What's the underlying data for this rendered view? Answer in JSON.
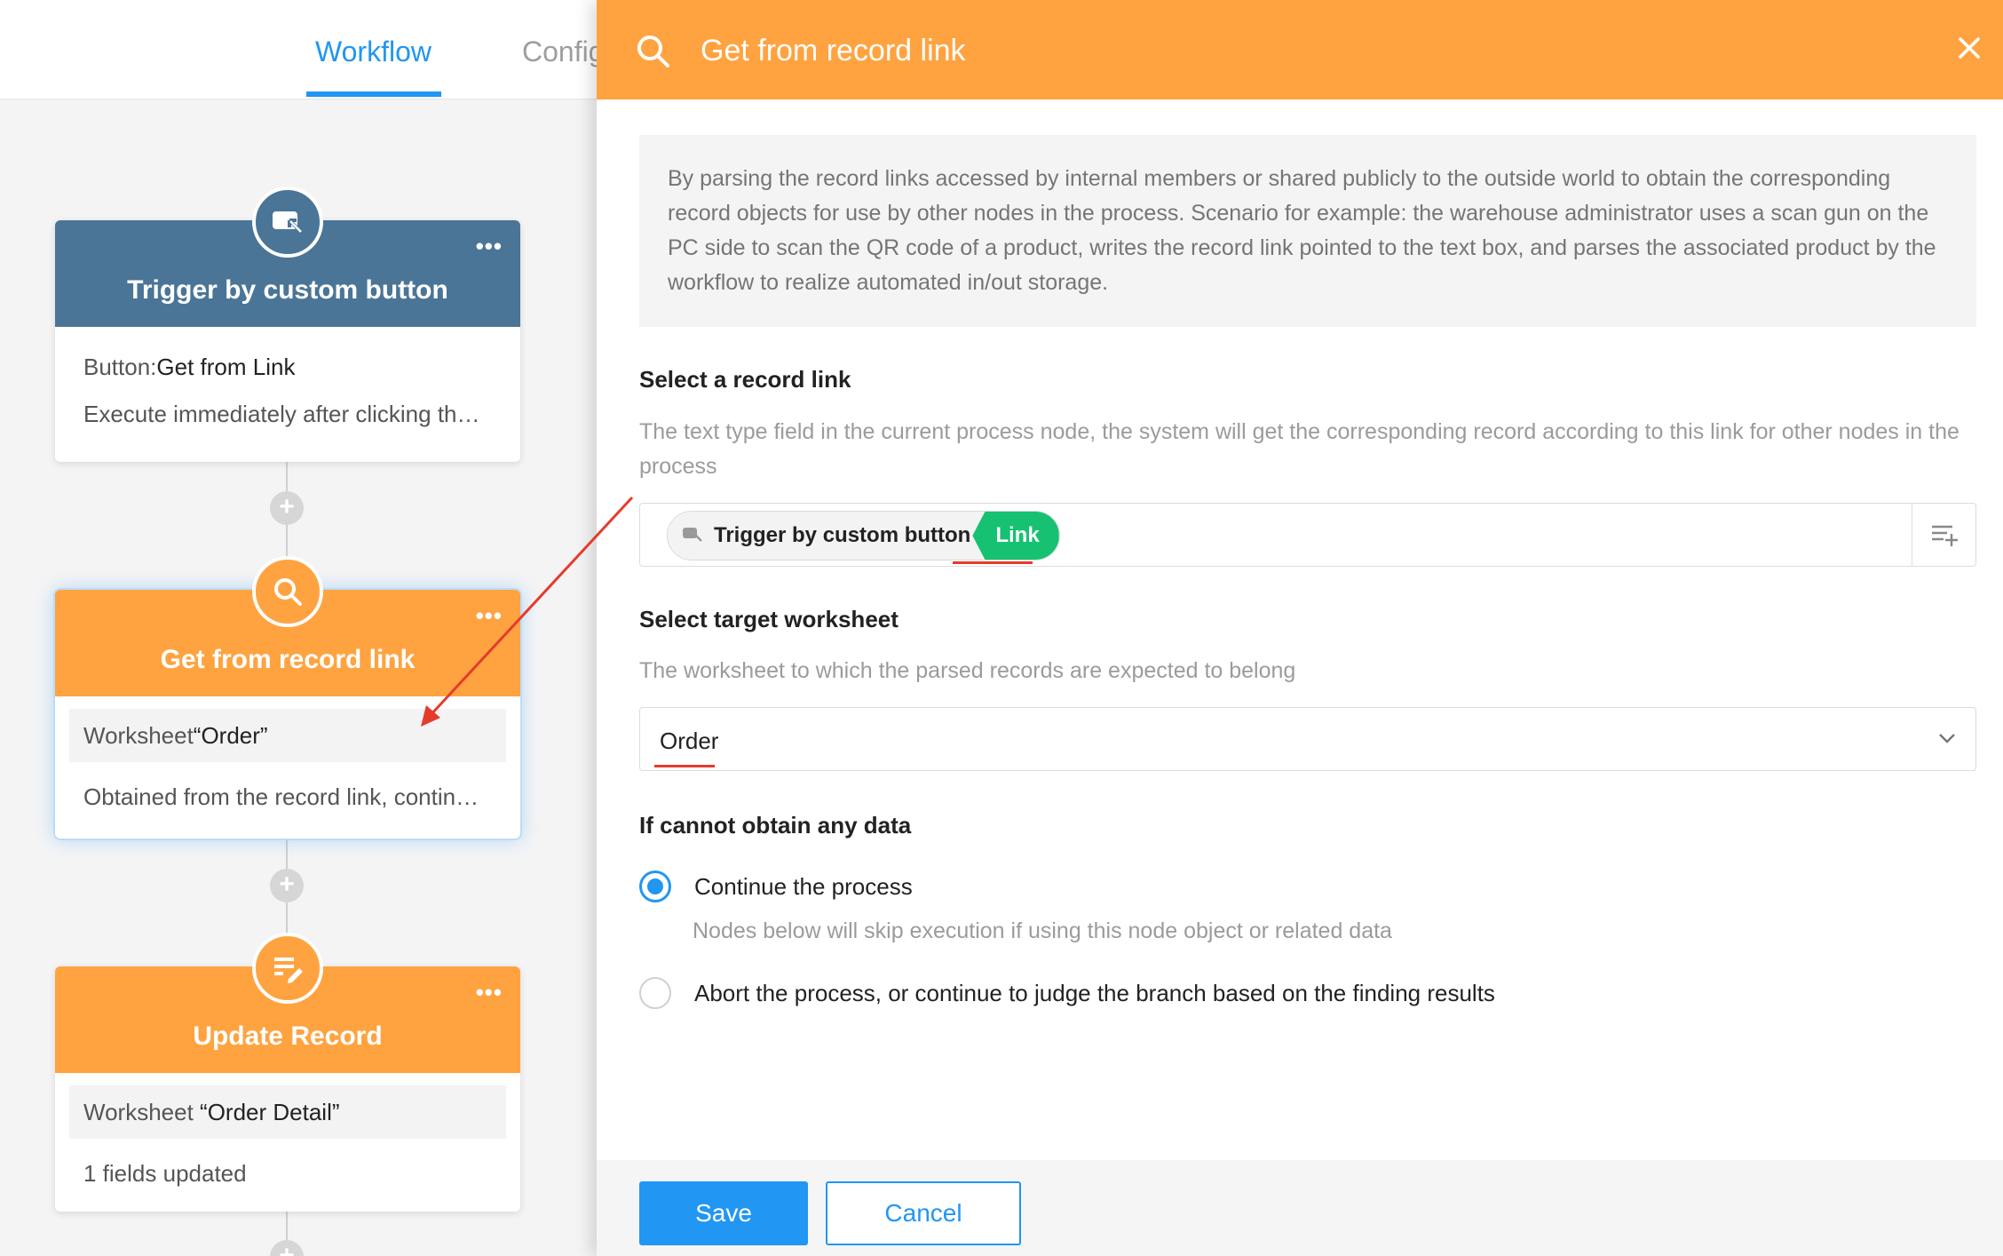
{
  "tabs": [
    {
      "label": "Workflow",
      "active": true
    },
    {
      "label": "Config",
      "active": false
    }
  ],
  "nodes": [
    {
      "title": "Trigger by custom button",
      "more": "•••",
      "color": "#4a7597",
      "icon": "custom-button-icon",
      "line1_label": "Button:",
      "line1_value": "Get from Link",
      "line2": "Execute immediately after clicking th…"
    },
    {
      "title": "Get from record link",
      "more": "•••",
      "color": "#ffa340",
      "icon": "search-icon",
      "line1_label": "Worksheet",
      "line1_value": "“Order”",
      "line2": "Obtained from the record link, contin…"
    },
    {
      "title": "Update Record",
      "more": "•••",
      "color": "#ffa340",
      "icon": "edit-list-icon",
      "line1_label": "Worksheet",
      "line1_value": "“Order Detail”",
      "line2": "1 fields updated"
    }
  ],
  "panel": {
    "title": "Get from record link",
    "accent": "#ffa340",
    "description": "By parsing the record links accessed by internal members or shared publicly to the outside world to obtain the corresponding record objects for use by other nodes in the process. Scenario for example: the warehouse administrator uses a scan gun on the PC side to scan the QR code of a product, writes the record link pointed to the text box, and parses the associated product by the workflow to realize automated in/out storage.",
    "record_link": {
      "title": "Select a record link",
      "hint": "The text type field in the current process node, the system will get the corresponding record according to this link for other nodes in the process",
      "tag_node": "Trigger by custom button",
      "tag_field": "Link"
    },
    "worksheet": {
      "title": "Select target worksheet",
      "hint": "The worksheet to which the parsed records are expected to belong",
      "value": "Order"
    },
    "no_data": {
      "title": "If cannot obtain any data",
      "options": [
        {
          "label": "Continue the process",
          "selected": true,
          "hint": "Nodes below will skip execution if using this node object or related data"
        },
        {
          "label": "Abort the process, or continue to judge the branch based on the finding results",
          "selected": false
        }
      ]
    },
    "buttons": {
      "save": "Save",
      "cancel": "Cancel"
    }
  }
}
